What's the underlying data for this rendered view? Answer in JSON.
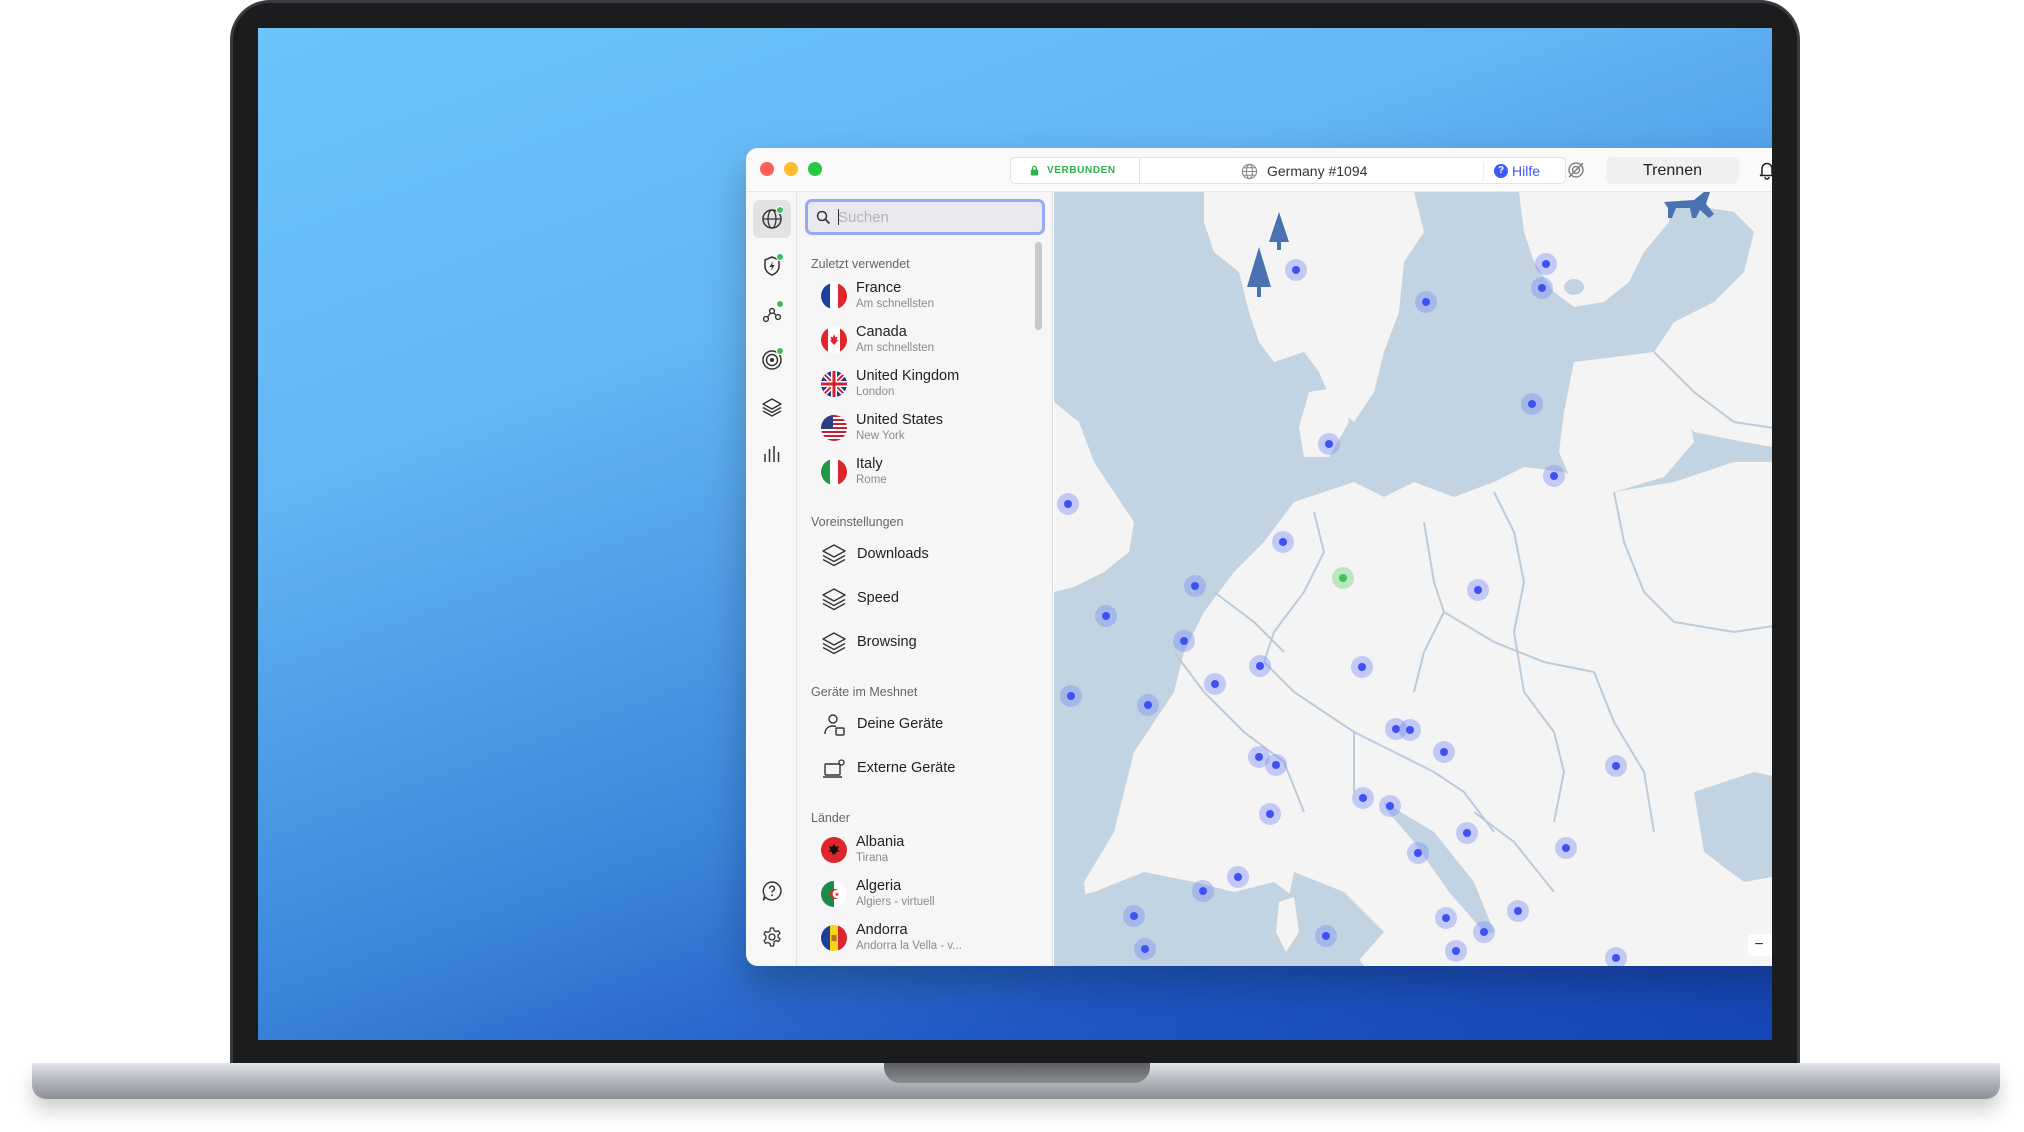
{
  "titlebar": {
    "status": "VERBUNDEN",
    "server": "Germany #1094",
    "help_label": "Hilfe",
    "disconnect_label": "Trennen"
  },
  "search": {
    "placeholder": "Suchen",
    "value": ""
  },
  "sections": {
    "recent": "Zuletzt verwendet",
    "presets": "Voreinstellungen",
    "meshnet": "Geräte im Meshnet",
    "countries": "Länder"
  },
  "recent": [
    {
      "name": "France",
      "sub": "Am schnellsten",
      "flag": "france"
    },
    {
      "name": "Canada",
      "sub": "Am schnellsten",
      "flag": "canada"
    },
    {
      "name": "United Kingdom",
      "sub": "London",
      "flag": "uk"
    },
    {
      "name": "United States",
      "sub": "New York",
      "flag": "usa"
    },
    {
      "name": "Italy",
      "sub": "Rome",
      "flag": "italy"
    }
  ],
  "presets": [
    {
      "name": "Downloads",
      "icon": "layers-icon"
    },
    {
      "name": "Speed",
      "icon": "layers-icon"
    },
    {
      "name": "Browsing",
      "icon": "layers-icon"
    }
  ],
  "meshnet": [
    {
      "name": "Deine Geräte",
      "icon": "user-device-icon"
    },
    {
      "name": "Externe Geräte",
      "icon": "external-device-icon"
    }
  ],
  "countries": [
    {
      "name": "Albania",
      "sub": "Tirana",
      "flag": "albania"
    },
    {
      "name": "Algeria",
      "sub": "Algiers - virtuell",
      "flag": "algeria"
    },
    {
      "name": "Andorra",
      "sub": "Andorra la Vella - v...",
      "flag": "andorra"
    }
  ],
  "map": {
    "zoom_out": "−",
    "zoom_in": "+",
    "connected_country": "Germany"
  },
  "colors": {
    "accent": "#3d5afe",
    "connected": "#2bb24c",
    "water": "#c2d3e1",
    "land": "#f4f4f4",
    "pin": "#3f51f0"
  }
}
